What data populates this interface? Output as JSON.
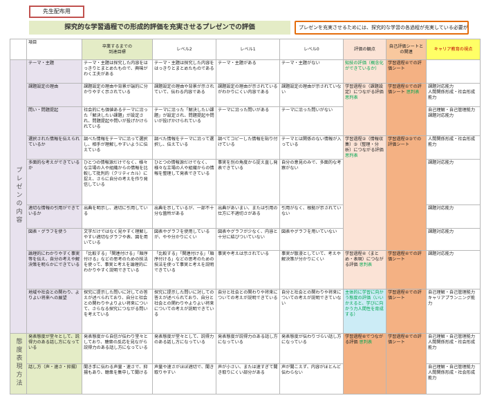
{
  "tag_label": "先生配布用",
  "title": "探究的な学習過程での形成的評価を充実させるプレゼンでの評価",
  "note": "プレゼンを充実させるためには、探究的な学習の各過程が充実している必要がある",
  "headers": {
    "item": "項目",
    "goal": "卒業するまでの\n到達目標",
    "lv2": "レベル2",
    "lv1": "レベル1",
    "lv0": "レベル0",
    "view": "評価の観点",
    "sheet": "自己評価シートとの関連",
    "career": "キャリア教育の視点"
  },
  "categories": {
    "presen": "プレゼンの内容",
    "attitude": "態度表現方法"
  },
  "rows": {
    "theme": {
      "item": "テーマ・主題",
      "goal": "テーマ・主題は探究した内容をはっきりとまとめたもので、興味がわく工夫がある",
      "lv2": "テーマ・主題は探究した内容をはっきりとまとめたものである",
      "lv1": "テーマ・主題がある",
      "lv0": "テーマ・主題がない",
      "view_a": "知技の評価（概念化ができているか）",
      "sheet": "学習過程④での評価シート",
      "career": ""
    },
    "reason": {
      "item": "課題設定の理由",
      "goal": "課題設定の理由や背景が端的に分かりやすく示されている",
      "lv2": "課題設定の理由や背景が示されていて、伝わる内容である",
      "lv1": "課題設定の理由が示されているがわかりにくい内容である",
      "lv0": "課題設定の理由が示されていない",
      "view_a": "学習過程①（課題設定）につながる評価",
      "view_b": "思判表",
      "sheet": "学習過程①での評価シート",
      "sheet_b": "思判表",
      "career": "課題対応能力\n人間関係形成・社会形成能力"
    },
    "question": {
      "item": "問い・問題提起",
      "goal": "社会的にも価値あるテーマに沿った「解決したい課題」が設定され、問題提起や問いが投げかけられている",
      "lv2": "テーマに沿った「解決したい課題」が設定され、問題提起や問いが投げかけられている",
      "lv1": "テーマに沿った問いがある",
      "lv0": "テーマに沿った問いがない",
      "career": "自己理解・自己管理能力\n課題対応能力"
    },
    "info": {
      "item": "選択された情報を伝えられているか",
      "goal": "調べた情報をテーマに沿って選択し、相手が理解しやすいように伝えている",
      "lv2": "調べた情報をテーマに沿って選択し、伝えている",
      "lv1": "調べてコピーした情報を貼り付けている",
      "lv0": "テーマとは関係のない情報が入っている",
      "view_a": "学習過程②（情報収集）③（整理・分析）につながる評価",
      "view_b": "思判表",
      "sheet": "学習過程②③での評価シート",
      "career": "人間関係形成・社会形成能力"
    },
    "multi": {
      "item": "多面的な考えができているか",
      "goal": "ひとつの情報源だけでなく、様々な立場の人や組織からの情報を比較して批判的（クリティカル）に捉え、さらに自分の考えを作り発信している",
      "lv2": "ひとつの情報源だけでなく、様々な立場の人や組織からの情報を整理して発表できている",
      "lv1": "事実を別の角度から捉え直し発表できている",
      "lv0": "自分の意見のみで、多面的な考察がない",
      "career": "課題対応能力"
    },
    "cite": {
      "item": "適切な情報の引用ができているか",
      "goal": "出典を明示し、適切に引用している",
      "lv2": "出典を示しているが、一部不十分な箇所がある",
      "lv1": "出典があいまい、または引用の仕方に不適切さがある",
      "lv0": "引用がなく、根拠が示されていない",
      "career": "課題対応能力"
    },
    "graph": {
      "item": "図表・グラフを使う",
      "goal": "文字だけではなく見やすく理解しやすい適切なグラフや表、図を用いている",
      "lv2": "図表やグラフを使用しているが、やや分かりにくい",
      "lv1": "図表やグラフが少なく、内容と十分に結びついていない",
      "lv0": "図表やグラフを用いていない",
      "career": "課題対応能力"
    },
    "logic": {
      "item": "論理的にわかりやすく事実等を伝え、自分の考えや解決策を明らかにできている",
      "goal": "「比較する」「関連付ける」「順序付ける」などの思考のための技法を使って、事実と考えを論理的にわかりやすく説明できている",
      "lv2": "「比較する」「関連付ける」「順序付ける」などの思考のための技法を使って事実と考えを説明できている",
      "lv1": "事実や考えは示されている",
      "lv0": "事実が散漫としていて、考えや解決策が分かりにくい",
      "view_a": "学習過程④（まとめ・表現）につながる評価",
      "view_b": "思判表",
      "sheet": "学習過程④での評価シート",
      "career": "課題対応能力"
    },
    "future": {
      "item": "地域や社会との関わり、よりよい将来への展望",
      "goal": "探究に提示した問いに対しての答えが述べられており、自分と社会との関わりやよりよい将来について、さらなる探究につながる問いを考えている",
      "lv2": "探究に提示した問いに対しての答えが述べられており、自分と社会との関わりやよりよい将来についての考えが説明できている",
      "lv1": "自分と社会との関わりや将来についての考えが説明できている",
      "lv0": "自分と社会との関わりや将来についての考えが説明できていない",
      "view_a": "主体的に学習に向かう態度の評価（いいかえると、学びに向かう力人間性を育成する）",
      "sheet": "学習過程④での評価シート",
      "career": "自己理解・自己管理能力\nキャリアプランニング能力"
    },
    "attitude": {
      "item": "発表態度が堂々として、説得力のある話し方になっている",
      "goal": "発表態度から自信が伝わり堂々としており、聴衆の反応を見ながら説得力のある話し方になっている",
      "lv2": "発表態度が堂々として、説得力のある話し方になっている",
      "lv1": "発表態度が説得力のある話し方になっている",
      "lv0": "発表態度が伝わりづらい話し方になっている",
      "view_a": "学習過程⑥でつながる評価",
      "view_b": "思判表",
      "sheet": "学習過程⑥での評価シート",
      "career": "自己理解・自己管理能力\n人間関係形成・社会形成能力"
    },
    "speech": {
      "item": "話し方（声・速さ・抑揚）",
      "goal": "聞き手に伝わる声量・速さで、抑揚もあり、聴衆を集中して聞ける",
      "lv2": "声量や速さがほぼ適切で、聞き取りやすい",
      "lv1": "声が小さい、または速すぎて聞き取りにくい部分がある",
      "lv0": "声が聞こえず、内容がほとんど伝わらない",
      "career": "自己理解・自己管理能力\n人間関係形成・社会形成能力"
    }
  }
}
